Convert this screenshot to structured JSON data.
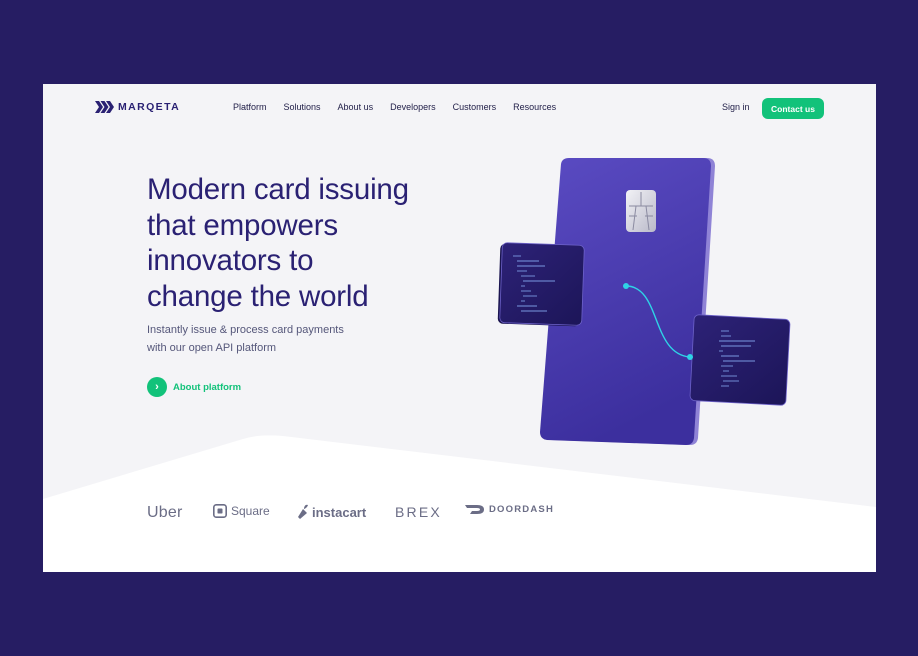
{
  "nav": {
    "logo_text": "MARQETA",
    "items": [
      "Platform",
      "Solutions",
      "About us",
      "Developers",
      "Customers",
      "Resources"
    ],
    "signin_label": "Sign in",
    "contact_label": "Contact us"
  },
  "hero": {
    "headline_lines": [
      "Modern card issuing",
      "that empowers",
      "innovators to",
      "change the world"
    ],
    "subtext_lines": [
      "Instantly issue & process card payments",
      "with our open API platform"
    ],
    "cta_label": "About platform"
  },
  "partners": [
    "Uber",
    "Square",
    "instacart",
    "BREX",
    "DOORDASH"
  ],
  "colors": {
    "outer_background": "#261d63",
    "brand_navy": "#2a2173",
    "accent_green": "#12c27a",
    "card_purple": "#4b3bb0",
    "connector_cyan": "#2fd3e6"
  }
}
